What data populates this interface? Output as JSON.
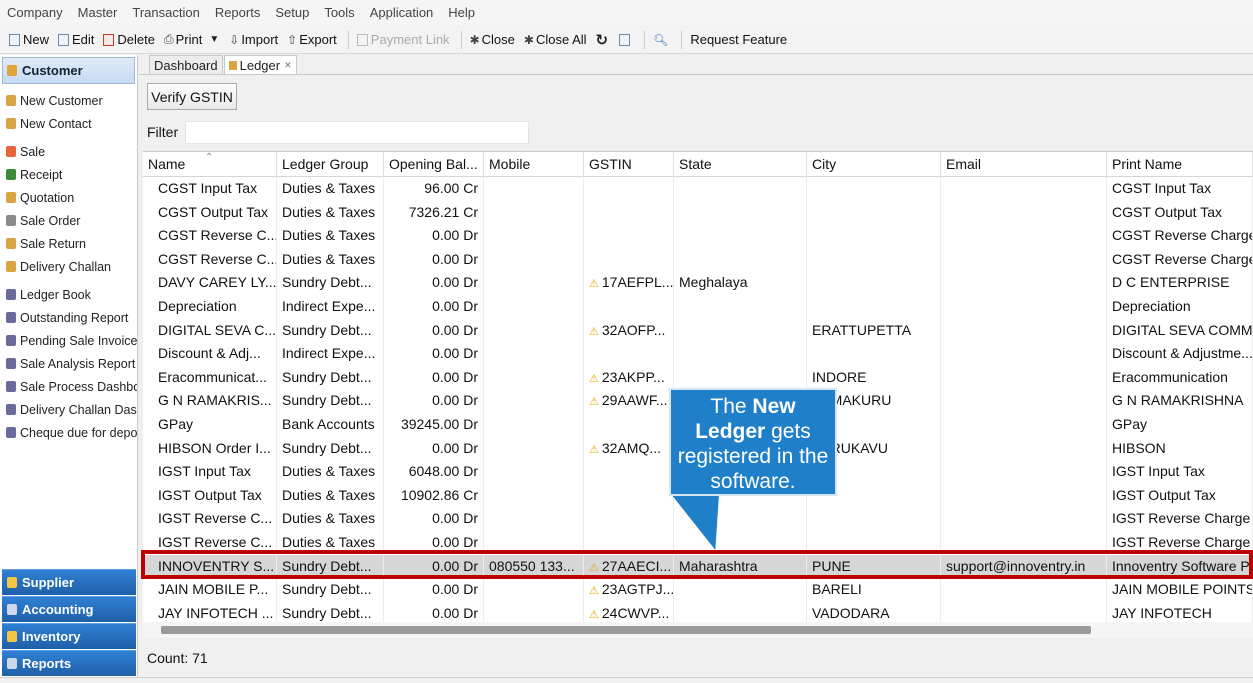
{
  "menu": [
    "Company",
    "Master",
    "Transaction",
    "Reports",
    "Setup",
    "Tools",
    "Application",
    "Help"
  ],
  "toolbar": {
    "new": "New",
    "edit": "Edit",
    "delete": "Delete",
    "print": "Print",
    "import": "Import",
    "export": "Export",
    "payment_link": "Payment Link",
    "close": "Close",
    "close_all": "Close All",
    "request_feature": "Request Feature"
  },
  "nav": {
    "header": "Customer",
    "items": [
      "New Customer",
      "New Contact",
      "Sale",
      "Receipt",
      "Quotation",
      "Sale Order",
      "Sale Return",
      "Delivery Challan",
      "Ledger Book",
      "Outstanding Report",
      "Pending Sale Invoices",
      "Sale Analysis Report",
      "Sale Process Dashboard",
      "Delivery Challan Dashboard",
      "Cheque due for deposit"
    ],
    "bottom": [
      "Supplier",
      "Accounting",
      "Inventory",
      "Reports"
    ]
  },
  "tabs": [
    "Dashboard",
    "Ledger"
  ],
  "verify_label": "Verify GSTIN",
  "filter_label": "Filter",
  "columns": [
    "Name",
    "Ledger Group",
    "Opening Bal...",
    "Mobile",
    "GSTIN",
    "State",
    "City",
    "Email",
    "Print Name"
  ],
  "rows": [
    [
      "CGST Input Tax",
      "Duties & Taxes",
      "96.00 Cr",
      "",
      "",
      "",
      "",
      "",
      "CGST Input Tax"
    ],
    [
      "CGST Output Tax",
      "Duties & Taxes",
      "7326.21 Cr",
      "",
      "",
      "",
      "",
      "",
      "CGST Output Tax"
    ],
    [
      "CGST Reverse C...",
      "Duties & Taxes",
      "0.00 Dr",
      "",
      "",
      "",
      "",
      "",
      "CGST Reverse Charge"
    ],
    [
      "CGST Reverse C...",
      "Duties & Taxes",
      "0.00 Dr",
      "",
      "",
      "",
      "",
      "",
      "CGST Reverse Charge"
    ],
    [
      "DAVY CAREY LY...",
      "Sundry Debt...",
      "0.00 Dr",
      "",
      "17AEFPL...",
      "Meghalaya",
      "",
      "",
      "D C ENTERPRISE"
    ],
    [
      "Depreciation",
      "Indirect Expe...",
      "0.00 Dr",
      "",
      "",
      "",
      "",
      "",
      "Depreciation"
    ],
    [
      "DIGITAL SEVA C...",
      "Sundry Debt...",
      "0.00 Dr",
      "",
      "32AOFP...",
      "",
      "ERATTUPETTA",
      "",
      "DIGITAL SEVA COMM..."
    ],
    [
      "Discount & Adj...",
      "Indirect Expe...",
      "0.00 Dr",
      "",
      "",
      "",
      "",
      "",
      "Discount & Adjustme..."
    ],
    [
      "Eracommunicat...",
      "Sundry Debt...",
      "0.00 Dr",
      "",
      "23AKPP...",
      "",
      "INDORE",
      "",
      "Eracommunication"
    ],
    [
      "G  N  RAMAKRIS...",
      "Sundry Debt...",
      "0.00 Dr",
      "",
      "29AAWF...",
      "",
      "TUMAKURU",
      "",
      "G  N  RAMAKRISHNA"
    ],
    [
      "GPay",
      "Bank Accounts",
      "39245.00 Dr",
      "",
      "",
      "",
      "",
      "",
      "GPay"
    ],
    [
      "HIBSON Order I...",
      "Sundry Debt...",
      "0.00 Dr",
      "",
      "32AMQ...",
      "",
      "PERUKAVU",
      "",
      "HIBSON"
    ],
    [
      "IGST Input Tax",
      "Duties & Taxes",
      "6048.00 Dr",
      "",
      "",
      "",
      "",
      "",
      "IGST Input Tax"
    ],
    [
      "IGST Output Tax",
      "Duties & Taxes",
      "10902.86 Cr",
      "",
      "",
      "",
      "",
      "",
      "IGST Output Tax"
    ],
    [
      "IGST Reverse C...",
      "Duties & Taxes",
      "0.00 Dr",
      "",
      "",
      "",
      "",
      "",
      "IGST Reverse Charge I..."
    ],
    [
      "IGST Reverse C...",
      "Duties & Taxes",
      "0.00 Dr",
      "",
      "",
      "",
      "",
      "",
      "IGST Reverse Charge ..."
    ],
    [
      "INNOVENTRY S...",
      "Sundry Debt...",
      "0.00 Dr",
      "080550 133...",
      "27AAECI...",
      "Maharashtra",
      "PUNE",
      "support@innoventry.in",
      "Innoventry Software P..."
    ],
    [
      "JAIN MOBILE P...",
      "Sundry Debt...",
      "0.00 Dr",
      "",
      "23AGTPJ...",
      "",
      "BARELI",
      "",
      "JAIN MOBILE POINTS"
    ],
    [
      "JAY INFOTECH ...",
      "Sundry Debt...",
      "0.00 Dr",
      "",
      "24CWVP...",
      "",
      "VADODARA",
      "",
      "JAY INFOTECH"
    ]
  ],
  "selected_row": 16,
  "count_text": "Count: 71",
  "callout": {
    "part1": "The ",
    "bold1": "New",
    "bold2": "Ledger",
    "part2": " gets registered in the software."
  }
}
